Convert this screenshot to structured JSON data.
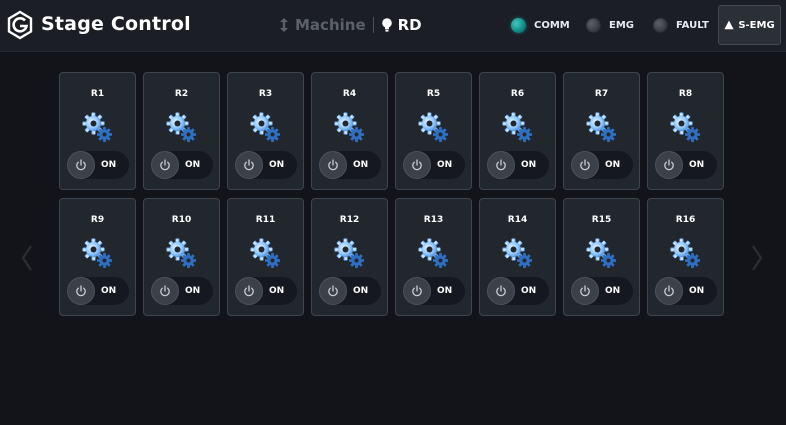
{
  "header": {
    "title": "Stage Control",
    "mode_inactive": "Machine",
    "mode_active": "RD",
    "indicators": [
      {
        "label": "COMM",
        "state": "on",
        "color": "#1aa39c"
      },
      {
        "label": "EMG",
        "state": "off",
        "color": "#45484f"
      },
      {
        "label": "FAULT",
        "state": "off",
        "color": "#45484f"
      }
    ],
    "semg_label": "S-EMG"
  },
  "icons": {
    "logo": "g-logo-icon",
    "machine": "updown-arrow-icon",
    "rd": "lightbulb-icon",
    "warn": "warning-triangle-icon",
    "gear": "gears-icon",
    "power": "power-icon",
    "prev": "chevron-left-icon",
    "next": "chevron-right-icon"
  },
  "colors": {
    "accent_gear": "#8fc6ff",
    "comm_on": "#1aa39c",
    "background": "#121419",
    "card_bg": "#22262d"
  },
  "relays": [
    {
      "label": "R1",
      "state": "ON"
    },
    {
      "label": "R2",
      "state": "ON"
    },
    {
      "label": "R3",
      "state": "ON"
    },
    {
      "label": "R4",
      "state": "ON"
    },
    {
      "label": "R5",
      "state": "ON"
    },
    {
      "label": "R6",
      "state": "ON"
    },
    {
      "label": "R7",
      "state": "ON"
    },
    {
      "label": "R8",
      "state": "ON"
    },
    {
      "label": "R9",
      "state": "ON"
    },
    {
      "label": "R10",
      "state": "ON"
    },
    {
      "label": "R11",
      "state": "ON"
    },
    {
      "label": "R12",
      "state": "ON"
    },
    {
      "label": "R13",
      "state": "ON"
    },
    {
      "label": "R14",
      "state": "ON"
    },
    {
      "label": "R15",
      "state": "ON"
    },
    {
      "label": "R16",
      "state": "ON"
    }
  ]
}
